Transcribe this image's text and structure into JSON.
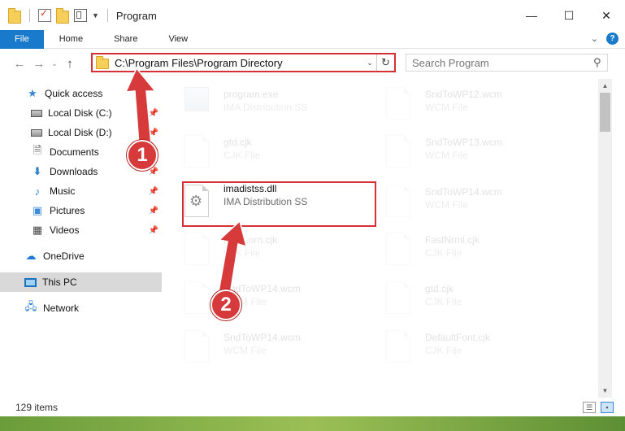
{
  "window": {
    "title": "Program",
    "minimize": "—",
    "maximize": "☐",
    "close": "✕"
  },
  "ribbon": {
    "tabs": [
      "File",
      "Home",
      "Share",
      "View"
    ]
  },
  "address": {
    "path": "C:\\Program Files\\Program Directory",
    "search_placeholder": "Search Program"
  },
  "nav": {
    "items": [
      {
        "label": "Quick access",
        "icon": "star-icon",
        "pinned": false
      },
      {
        "label": "Local Disk (C:)",
        "icon": "drive-icon",
        "pinned": true
      },
      {
        "label": "Local Disk (D:)",
        "icon": "drive-icon",
        "pinned": true
      },
      {
        "label": "Documents",
        "icon": "document-icon",
        "pinned": true
      },
      {
        "label": "Downloads",
        "icon": "download-icon",
        "pinned": true
      },
      {
        "label": "Music",
        "icon": "music-icon",
        "pinned": true
      },
      {
        "label": "Pictures",
        "icon": "picture-icon",
        "pinned": true
      },
      {
        "label": "Videos",
        "icon": "video-icon",
        "pinned": true
      },
      {
        "label": "OneDrive",
        "icon": "cloud-icon",
        "pinned": false
      },
      {
        "label": "This PC",
        "icon": "computer-icon",
        "pinned": false,
        "selected": true
      },
      {
        "label": "Network",
        "icon": "network-icon",
        "pinned": false
      }
    ]
  },
  "files": {
    "col1": [
      {
        "name": "program.exe",
        "type": "IMA Distribution SS",
        "icon": "exe-icon"
      },
      {
        "name": "gtd.cjk",
        "type": "CJK File",
        "icon": "page-icon"
      },
      {
        "name": "imadistss.dll",
        "type": "IMA Distribution SS",
        "icon": "gear-page-icon",
        "highlighted": true
      },
      {
        "name": "Fo...Lorn.cjk",
        "type": "CJK File",
        "icon": "page-icon"
      },
      {
        "name": "SndToWP14.wcm",
        "type": "WCM File",
        "icon": "page-icon"
      },
      {
        "name": "SndToWP14.wcm",
        "type": "WCM File",
        "icon": "page-icon"
      }
    ],
    "col2": [
      {
        "name": "SndToWP12.wcm",
        "type": "WCM File",
        "icon": "page-icon"
      },
      {
        "name": "SndToWP13.wcm",
        "type": "WCM File",
        "icon": "page-icon"
      },
      {
        "name": "SndToWP14.wcm",
        "type": "WCM File",
        "icon": "page-icon"
      },
      {
        "name": "FastNrml.cjk",
        "type": "CJK File",
        "icon": "page-icon"
      },
      {
        "name": "gtd.cjk",
        "type": "CJK File",
        "icon": "page-icon"
      },
      {
        "name": "DefaultFont.cjk",
        "type": "CJK File",
        "icon": "page-icon"
      }
    ]
  },
  "status": {
    "item_count": "129 items"
  },
  "annotations": {
    "badge1": "1",
    "badge2": "2"
  },
  "colors": {
    "accent": "#1979ca",
    "highlight": "#d43035"
  }
}
